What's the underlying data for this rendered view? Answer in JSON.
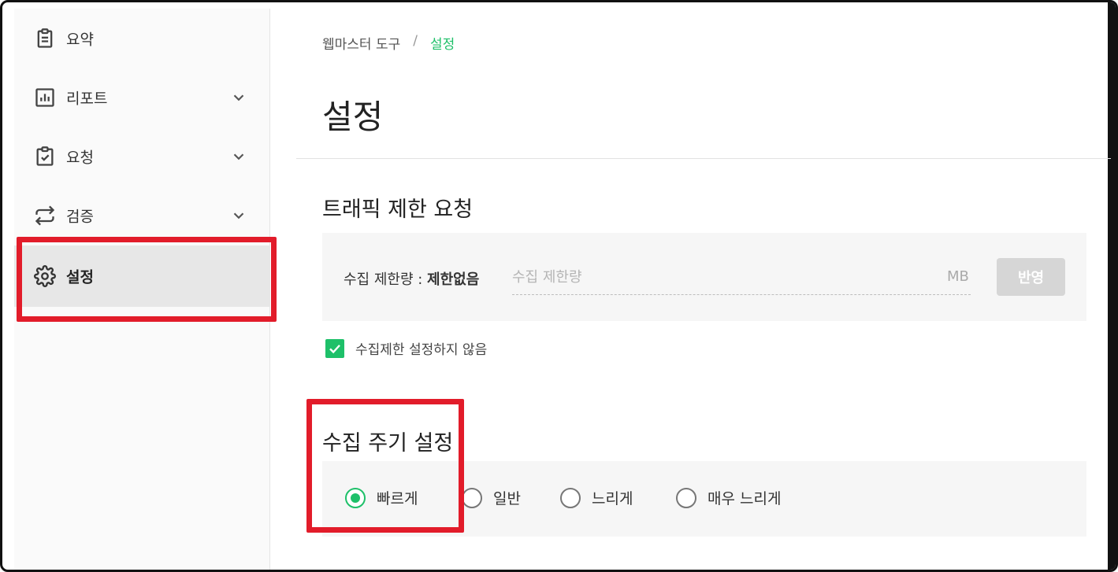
{
  "sidebar": {
    "items": [
      {
        "label": "요약",
        "icon": "clipboard-icon",
        "has_chevron": false
      },
      {
        "label": "리포트",
        "icon": "bar-chart-icon",
        "has_chevron": true
      },
      {
        "label": "요청",
        "icon": "clipboard-check-icon",
        "has_chevron": true
      },
      {
        "label": "검증",
        "icon": "repeat-icon",
        "has_chevron": true
      },
      {
        "label": "설정",
        "icon": "gear-icon",
        "has_chevron": false,
        "active": true
      }
    ]
  },
  "breadcrumb": {
    "root": "웹마스터 도구",
    "separator": "/",
    "current": "설정"
  },
  "page_title": "설정",
  "traffic_section": {
    "title": "트래픽 제한 요청",
    "limit_label": "수집 제한량 :",
    "limit_value": "제한없음",
    "input_placeholder": "수집 제한량",
    "unit": "MB",
    "apply_label": "반영",
    "checkbox_label": "수집제한 설정하지 않음",
    "checkbox_checked": true
  },
  "cycle_section": {
    "title": "수집 주기 설정",
    "options": [
      {
        "label": "빠르게",
        "selected": true
      },
      {
        "label": "일반",
        "selected": false
      },
      {
        "label": "느리게",
        "selected": false
      },
      {
        "label": "매우 느리게",
        "selected": false
      }
    ]
  },
  "colors": {
    "accent": "#1ec069",
    "highlight": "#e21c2a",
    "button_disabled": "#d6d6d6"
  }
}
